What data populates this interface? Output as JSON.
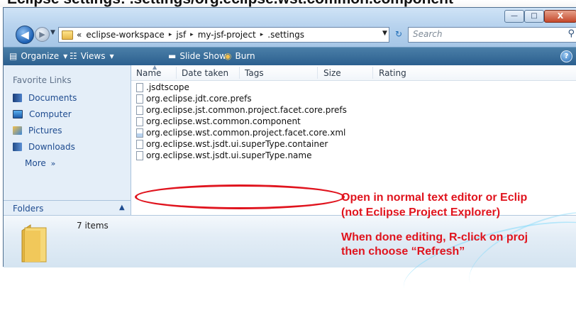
{
  "title_fragment": "Eclipse settings: .settings/org.eclipse.wst.common.component",
  "window": {
    "caption_buttons": {
      "minimize": "—",
      "maximize": "□",
      "close": "X"
    },
    "address": {
      "prefix": "«",
      "crumbs": [
        "eclipse-workspace",
        "jsf",
        "my-jsf-project",
        ".settings"
      ],
      "separator": "▸"
    },
    "search": {
      "placeholder": "Search"
    }
  },
  "toolbar": {
    "organize": "Organize",
    "views": "Views",
    "slideshow": "Slide Show",
    "burn": "Burn"
  },
  "nav": {
    "favorites_header": "Favorite Links",
    "items": [
      "Documents",
      "Computer",
      "Pictures",
      "Downloads"
    ],
    "more": "More",
    "folders": "Folders"
  },
  "columns": [
    "Name",
    "Date taken",
    "Tags",
    "Size",
    "Rating"
  ],
  "files": [
    {
      "name": ".jsdtscope",
      "icon": "file-icon"
    },
    {
      "name": "org.eclipse.jdt.core.prefs",
      "icon": "file-icon"
    },
    {
      "name": "org.eclipse.jst.common.project.facet.core.prefs",
      "icon": "file-icon"
    },
    {
      "name": "org.eclipse.wst.common.component",
      "icon": "file-icon"
    },
    {
      "name": "org.eclipse.wst.common.project.facet.core.xml",
      "icon": "xml-file-icon"
    },
    {
      "name": "org.eclipse.wst.jsdt.ui.superType.container",
      "icon": "file-icon"
    },
    {
      "name": "org.eclipse.wst.jsdt.ui.superType.name",
      "icon": "file-icon"
    }
  ],
  "status": {
    "item_count": "7 items"
  },
  "annotations": {
    "line1": "Open in normal text editor or Eclip",
    "line2": "(not Eclipse Project Explorer)",
    "line3": "When done editing, R-click on proj",
    "line4": "then choose “Refresh”"
  },
  "colors": {
    "annotation": "#e0141e",
    "toolbar": "#2b5f8f",
    "link": "#1e4b8f"
  }
}
